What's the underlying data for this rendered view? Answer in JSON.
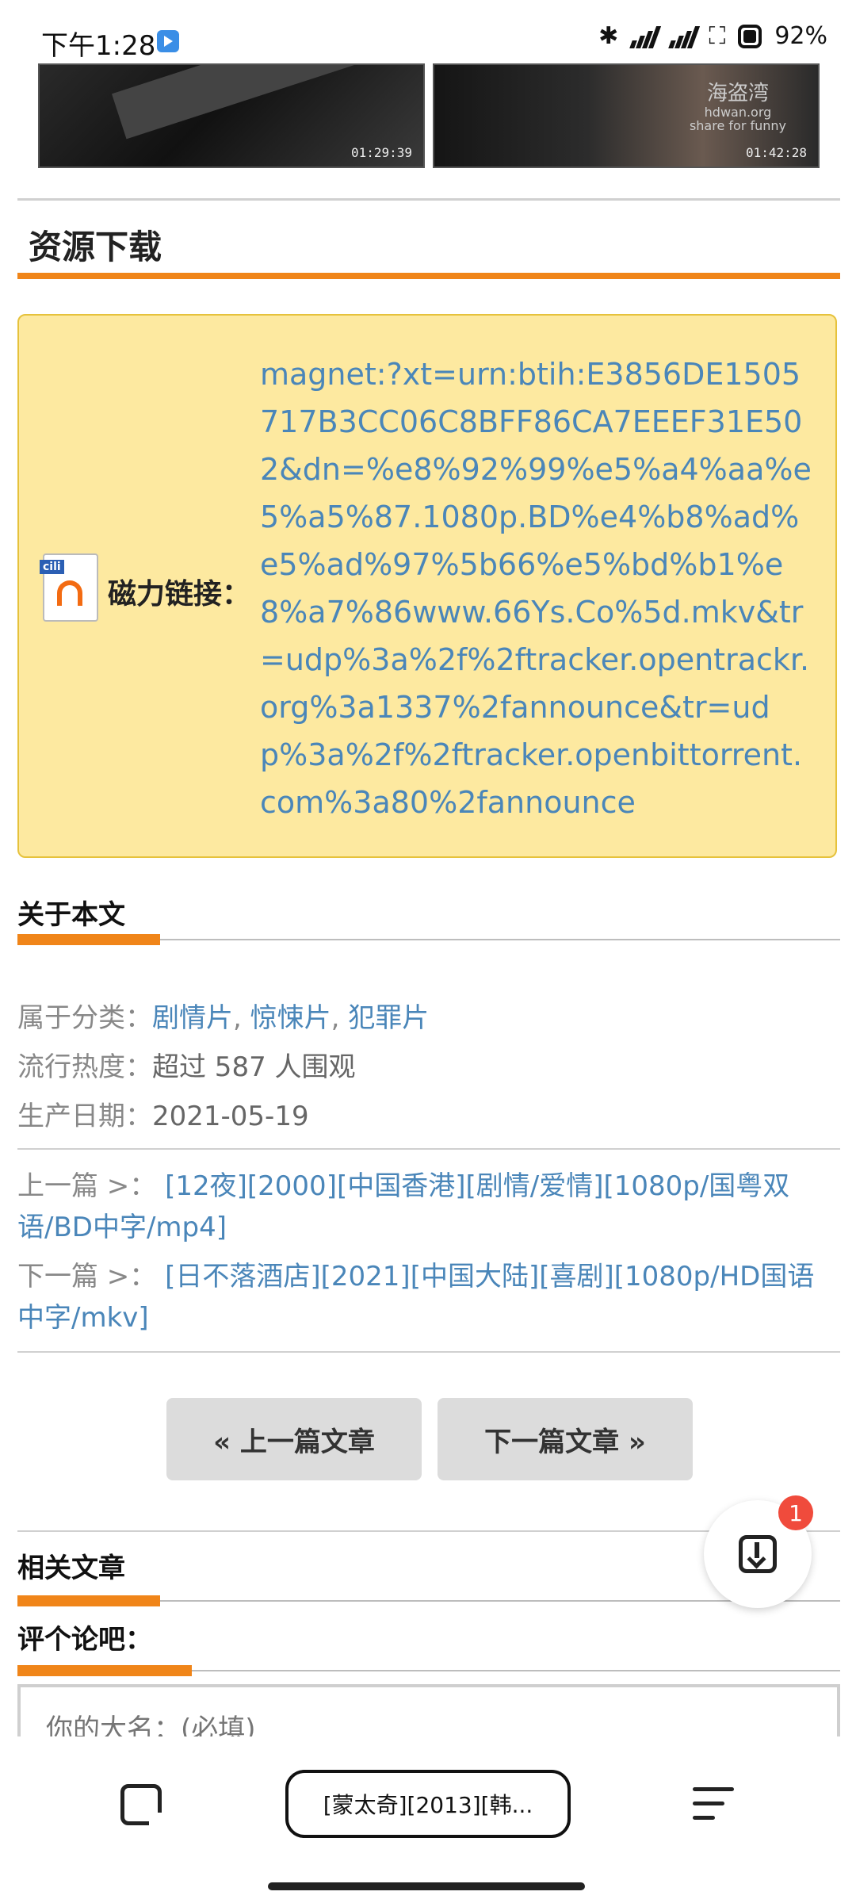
{
  "status_bar": {
    "time": "下午1:28",
    "battery": "92%",
    "icons": [
      "notification-icon",
      "bluetooth-icon",
      "signal-hd-icon",
      "signal-hd-icon",
      "screenshot-icon",
      "battery-icon"
    ]
  },
  "thumbnails": [
    {
      "timestamp": "01:29:39"
    },
    {
      "timestamp": "01:42:28",
      "watermark": "海盗湾",
      "watermark_sub": "hdwan.org",
      "watermark_sub2": "share for funny"
    }
  ],
  "download_section": {
    "title": "资源下载",
    "magnet_label": "磁力链接：",
    "icon_tag": "cili",
    "magnet_link": "magnet:?xt=urn:btih:E3856DE1505717B3CC06C8BFF86CA7EEEF31E502&dn=%e8%92%99%e5%a4%aa%e5%a5%87.1080p.BD%e4%b8%ad%e5%ad%97%5b66%e5%bd%b1%e8%a7%86www.66Ys.Co%5d.mkv&tr=udp%3a%2f%2ftracker.opentrackr.org%3a1337%2fannounce&tr=udp%3a%2f%2ftracker.openbittorrent.com%3a80%2fannounce"
  },
  "about": {
    "title": "关于本文",
    "category_label": "属于分类：",
    "categories": [
      "剧情片",
      "惊悚片",
      "犯罪片"
    ],
    "popularity_label": "流行热度：",
    "popularity_value": "超过 587 人围观",
    "date_label": "生产日期：",
    "date_value": "2021-05-19",
    "prev_label": "上一篇 >：",
    "prev_title": "[12夜][2000][中国香港][剧情/爱情][1080p/国粤双语/BD中字/mp4]",
    "next_label": "下一篇 >：",
    "next_title": "[日不落酒店][2021][中国大陆][喜剧][1080p/HD国语中字/mkv]"
  },
  "buttons": {
    "prev": "« 上一篇文章",
    "next": "下一篇文章 »"
  },
  "fab": {
    "badge": "1"
  },
  "related": {
    "title": "相关文章"
  },
  "comment": {
    "title": "评个论吧：",
    "name_placeholder": "你的大名：(必填)"
  },
  "bottom_bar": {
    "url_title": "[蒙太奇][2013][韩..."
  }
}
